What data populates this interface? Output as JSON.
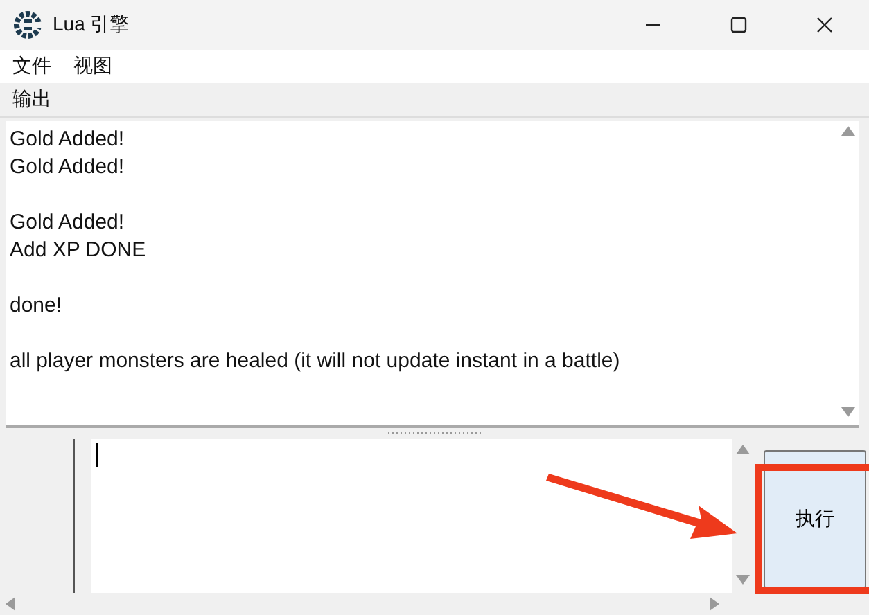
{
  "window": {
    "title": "Lua 引擎"
  },
  "menu": [
    {
      "label": "文件"
    },
    {
      "label": "视图"
    }
  ],
  "output": {
    "label": "输出",
    "paragraphs": [
      [
        "Gold Added!",
        "Gold Added!"
      ],
      [
        "Gold Added!",
        "Add XP DONE"
      ],
      [
        "done!"
      ],
      [
        "all player monsters are healed (it will not update instant in a battle)"
      ]
    ]
  },
  "editor": {
    "button": "执行"
  }
}
